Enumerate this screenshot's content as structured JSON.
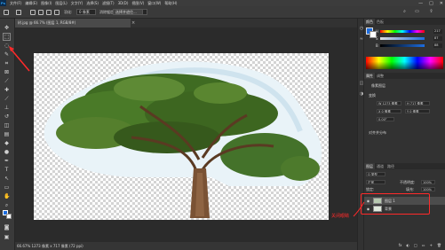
{
  "menubar": {
    "logo": "Ps",
    "items": [
      "文件(F)",
      "编辑(E)",
      "图像(I)",
      "图层(L)",
      "文字(Y)",
      "选择(S)",
      "滤镜(T)",
      "3D(D)",
      "视图(V)",
      "窗口(W)",
      "帮助(H)"
    ],
    "window_controls": [
      "—",
      "□",
      "✕"
    ]
  },
  "options": {
    "feather_label": "羽化:",
    "feather_value": "0 像素",
    "antialias_label": "消除锯齿",
    "style_label": "样式:",
    "style_value": "正常",
    "select_mask_button": "选择并遮住..."
  },
  "document": {
    "tab_title": "树.jpg @ 66.7% (图层 1, RGB/8#)",
    "close": "×"
  },
  "status": {
    "text": "66.67%  1273 像素 x 717 像素 (72 ppi)"
  },
  "panels": {
    "color_tabs": [
      "颜色",
      "色板"
    ],
    "sliders": [
      {
        "letter": "H",
        "value": "217"
      },
      {
        "letter": "S",
        "value": "87"
      },
      {
        "letter": "B",
        "value": "88"
      }
    ],
    "properties_tabs": [
      "属性",
      "调整"
    ],
    "properties_subtitle": "像素图层",
    "transform_label": "变换",
    "fields": [
      "W 1273 像素",
      "H 717 像素",
      "X 0 像素",
      "Y 0 像素",
      "0.00°"
    ],
    "align_label": "对齐并分布",
    "layers_tabs": [
      "图层",
      "通道",
      "路径"
    ],
    "layer_kind": "Q 类型",
    "blend_mode": "正常",
    "opacity_label": "不透明度:",
    "opacity_value": "100%",
    "lock_label": "锁定:",
    "fill_label": "填充:",
    "fill_value": "100%",
    "layers": [
      {
        "name": "图层 1",
        "selected": true
      },
      {
        "name": "背景",
        "selected": false
      }
    ],
    "bottom_icons": [
      "fx",
      "◐",
      "□",
      "▭",
      "+",
      "🗑"
    ]
  },
  "annotation": {
    "label": "关闭眼睛",
    "color": "#ff2a2a"
  },
  "colors": {
    "foreground": "#1d6de0",
    "background": "#ffffff",
    "accent": "#31a8ff"
  }
}
